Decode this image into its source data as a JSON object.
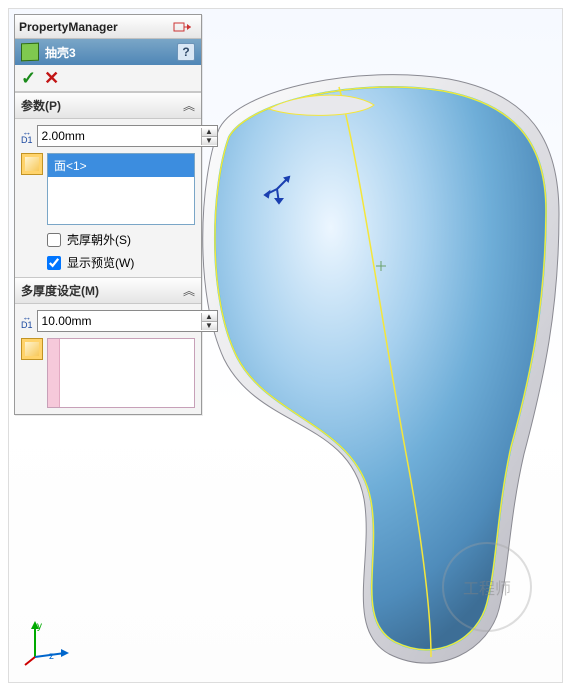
{
  "pm": {
    "title": "PropertyManager",
    "feature_name": "抽壳3",
    "help_glyph": "?",
    "ok_glyph": "✓",
    "cancel_glyph": "✕",
    "pin_glyph": "⇥"
  },
  "params": {
    "header": "参数(P)",
    "chevron": "︽",
    "thickness_value": "2.00mm",
    "dim_label": "D1",
    "selected_face": "面<1>",
    "shell_outward_label": "壳厚朝外(S)",
    "shell_outward_checked": false,
    "show_preview_label": "显示预览(W)",
    "show_preview_checked": true
  },
  "multi": {
    "header": "多厚度设定(M)",
    "chevron": "︽",
    "thickness_value": "10.00mm",
    "dim_label": "D1"
  },
  "triad": {
    "y_label": "y",
    "z_label": "z"
  },
  "watermark_text": "工程师"
}
